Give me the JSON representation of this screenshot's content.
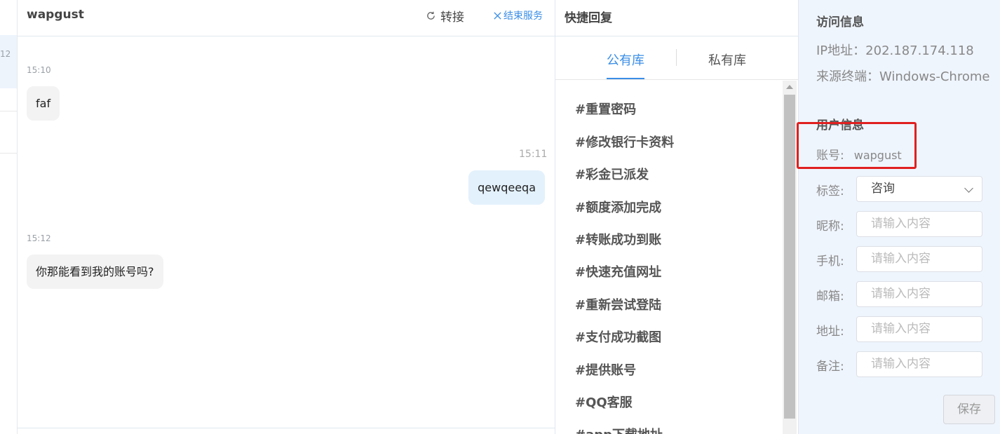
{
  "left_sliver": {
    "partial_number": "12"
  },
  "chat": {
    "title": "wapgust",
    "transfer_label": "转接",
    "end_service_label": "结束服务",
    "messages": [
      {
        "time": "15:10",
        "text": "faf",
        "side": "left"
      },
      {
        "time": "15:11",
        "text": "qewqeeqa",
        "side": "right"
      },
      {
        "time": "15:12",
        "text": "你那能看到我的账号吗?",
        "side": "left"
      }
    ]
  },
  "quick_reply": {
    "title": "快捷回复",
    "tabs": [
      {
        "label": "公有库",
        "active": true
      },
      {
        "label": "私有库",
        "active": false
      }
    ],
    "items": [
      "#重置密码",
      "#修改银行卡资料",
      "#彩金已派发",
      "#额度添加完成",
      "#转账成功到账",
      "#快速充值网址",
      "#重新尝试登陆",
      "#支付成功截图",
      "#提供账号",
      "#QQ客服",
      "#app下载地址"
    ]
  },
  "info": {
    "visit_title": "访问信息",
    "ip_line": "IP地址：202.187.174.118",
    "terminal_line": "来源终端：Windows-Chrome",
    "user_title": "用户信息",
    "account_label": "账号:",
    "account_value": "wapgust",
    "tag_label": "标签:",
    "tag_value": "咨询",
    "fields": [
      {
        "label": "昵称:",
        "placeholder": "请输入内容"
      },
      {
        "label": "手机:",
        "placeholder": "请输入内容"
      },
      {
        "label": "邮箱:",
        "placeholder": "请输入内容"
      },
      {
        "label": "地址:",
        "placeholder": "请输入内容"
      },
      {
        "label": "备注:",
        "placeholder": "请输入内容"
      }
    ],
    "save_label": "保存"
  },
  "colors": {
    "accent": "#3a8ee6",
    "highlight_box": "#e02020",
    "info_bg": "#eff5fd",
    "right_bubble": "#e3f1fc"
  }
}
